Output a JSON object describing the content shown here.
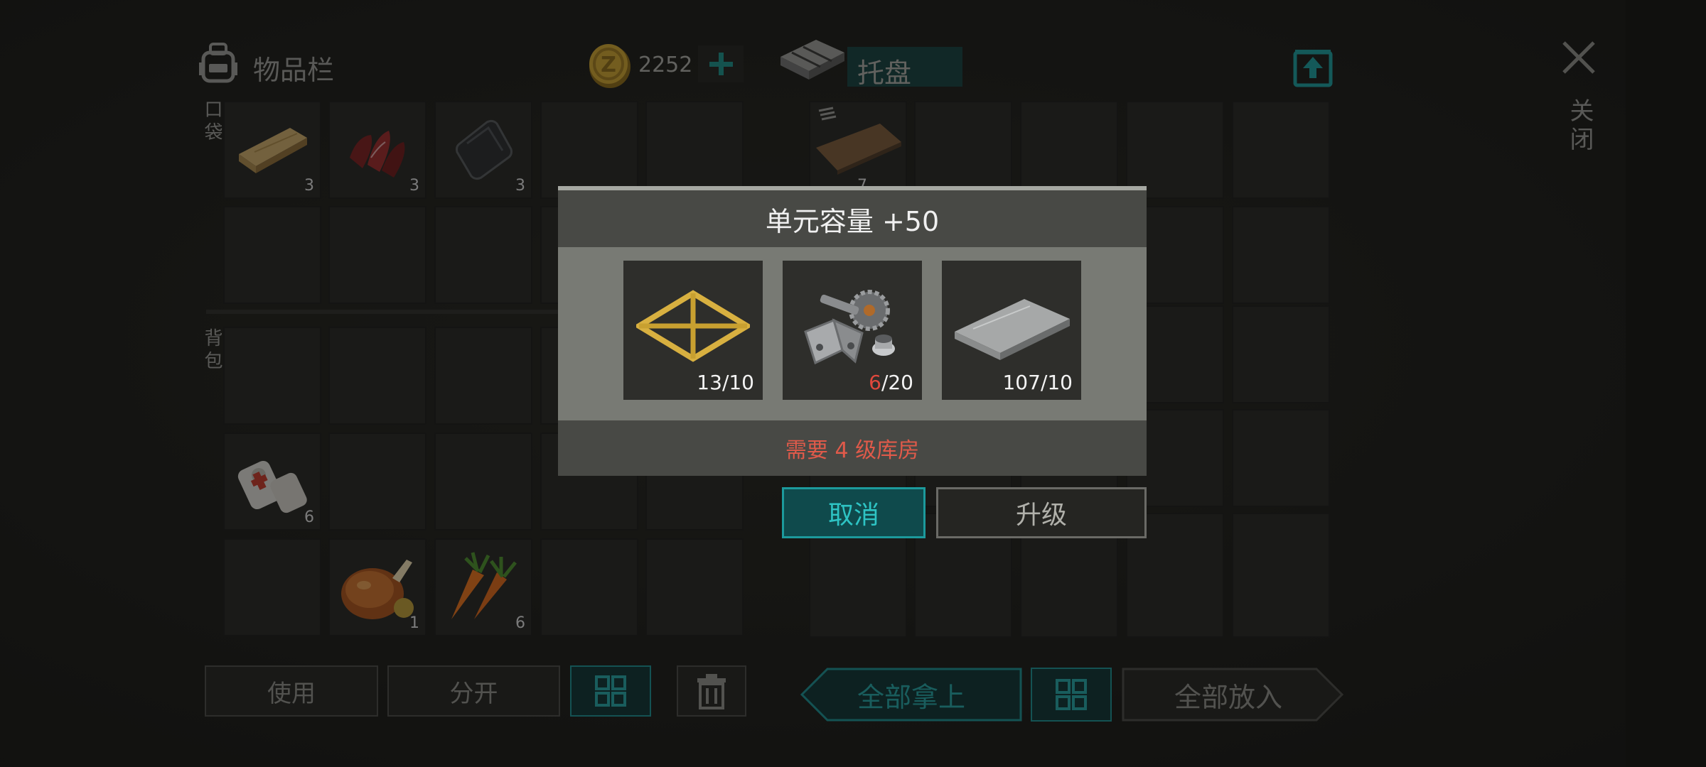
{
  "inventory": {
    "title": "物品栏",
    "icon": "backpack-icon",
    "coins": "2252",
    "pocket_label": "口袋",
    "backpack_label": "背包",
    "items": [
      {
        "name": "wood-plank",
        "qty": "3"
      },
      {
        "name": "raw-meat",
        "qty": "3"
      },
      {
        "name": "iron-plate",
        "qty": "3"
      },
      {
        "name": "bandage",
        "qty": "6"
      },
      {
        "name": "roast-chicken",
        "qty": "1"
      },
      {
        "name": "carrot",
        "qty": "6"
      }
    ],
    "buttons": {
      "use": "使用",
      "split": "分开"
    }
  },
  "pallet": {
    "title": "托盘",
    "items": [
      {
        "name": "wood-board",
        "qty": "7"
      }
    ],
    "buttons": {
      "take_all": "全部拿上",
      "put_all": "全部放入"
    }
  },
  "close_label": "关闭",
  "dialog": {
    "title": "单元容量 +50",
    "materials": [
      {
        "name": "frame",
        "have": "13",
        "need": "/10",
        "sufficient": true
      },
      {
        "name": "hinge-gear-parts",
        "have": "6",
        "need": "/20",
        "sufficient": false
      },
      {
        "name": "metal-sheet",
        "have": "107",
        "need": "/10",
        "sufficient": true
      }
    ],
    "requirement": "需要 4 级库房",
    "cancel": "取消",
    "upgrade": "升级"
  },
  "colors": {
    "accent": "#1c8c8e",
    "warning": "#e05a4a",
    "coin": "#c9a030"
  }
}
